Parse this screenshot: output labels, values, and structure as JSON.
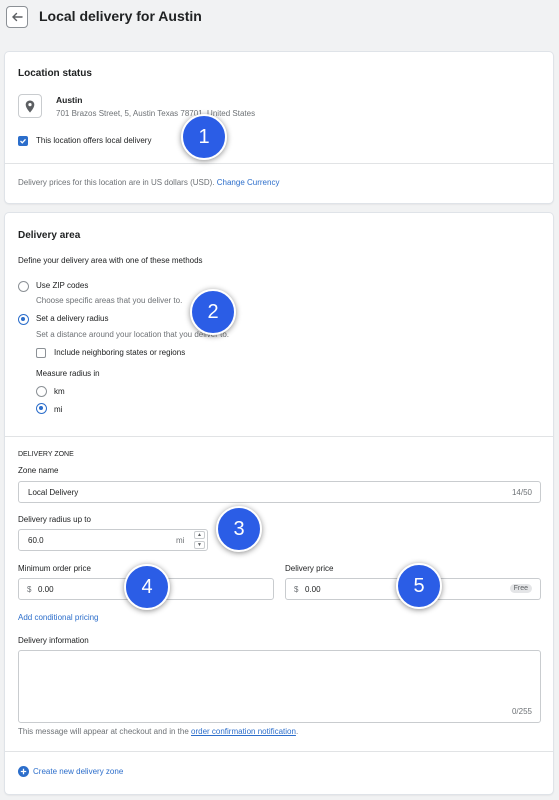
{
  "header": {
    "title": "Local delivery for Austin"
  },
  "location_status": {
    "heading": "Location status",
    "location_name": "Austin",
    "address": "701 Brazos Street, 5, Austin Texas 78701, United States",
    "offers_local_delivery_label": "This location offers local delivery",
    "offers_local_delivery_checked": true,
    "currency_note": "Delivery prices for this location are in US dollars (USD).",
    "change_currency_link": "Change Currency"
  },
  "delivery_area": {
    "heading": "Delivery area",
    "instructions": "Define your delivery area with one of these methods",
    "methods": [
      {
        "label": "Use ZIP codes",
        "help": "Choose specific areas that you deliver to.",
        "selected": false
      },
      {
        "label": "Set a delivery radius",
        "help": "Set a distance around your location that you deliver to.",
        "selected": true
      }
    ],
    "include_neighboring_label": "Include neighboring states or regions",
    "include_neighboring_checked": false,
    "measure_label": "Measure radius in",
    "units": [
      {
        "label": "km",
        "selected": false
      },
      {
        "label": "mi",
        "selected": true
      }
    ]
  },
  "delivery_zone": {
    "section_title": "DELIVERY ZONE",
    "zone_name_label": "Zone name",
    "zone_name_value": "Local Delivery",
    "zone_name_count": "14/50",
    "radius_label": "Delivery radius up to",
    "radius_value": "60.0",
    "radius_unit": "mi",
    "min_order_label": "Minimum order price",
    "min_order_currency": "$",
    "min_order_value": "0.00",
    "delivery_price_label": "Delivery price",
    "delivery_price_currency": "$",
    "delivery_price_value": "0.00",
    "delivery_price_badge": "Free",
    "conditional_pricing_link": "Add conditional pricing",
    "info_label": "Delivery information",
    "info_count": "0/255",
    "checkout_note_prefix": "This message will appear at checkout and in the",
    "checkout_note_link": "order confirmation notification",
    "checkout_note_suffix": ".",
    "create_zone_label": "Create new delivery zone"
  },
  "callouts": [
    "1",
    "2",
    "3",
    "4",
    "5"
  ],
  "colors": {
    "accent": "#2c6ecb",
    "callout": "#2b5de6",
    "background": "#f1f2f3"
  }
}
